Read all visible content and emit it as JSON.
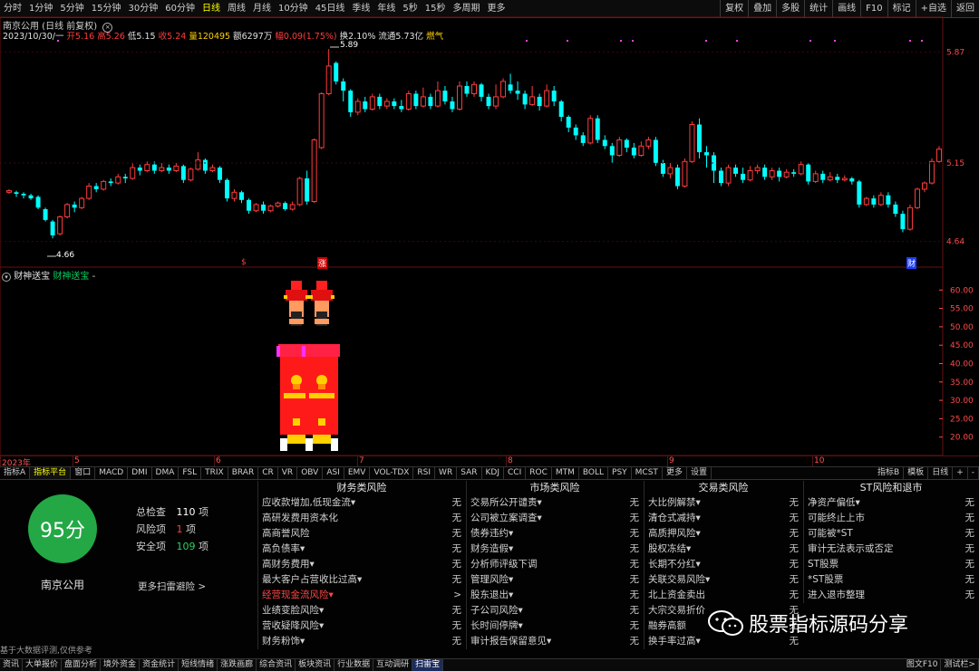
{
  "periods": [
    "分时",
    "1分钟",
    "5分钟",
    "15分钟",
    "30分钟",
    "60分钟",
    "日线",
    "周线",
    "月线",
    "10分钟",
    "45日线",
    "季线",
    "年线",
    "5秒",
    "15秒",
    "多周期",
    "更多"
  ],
  "active_period": "日线",
  "right_tools": [
    "复权",
    "叠加",
    "多股",
    "统计",
    "画线",
    "F10",
    "标记",
    "+自选",
    "返回"
  ],
  "stock": {
    "title": "南京公用 (日线 前复权)"
  },
  "quote": {
    "date": "2023/10/30/一",
    "open_label": "开",
    "open": "5.16",
    "high_label": "高",
    "high": "5.26",
    "low_label": "低",
    "low": "5.15",
    "close_label": "收",
    "close": "5.24",
    "vol_label": "量",
    "vol": "120495",
    "amt_label": "额",
    "amt": "6297万",
    "chg_label": "幅",
    "chg": "0.09(1.75%)",
    "turn_label": "换",
    "turn": "2.10%",
    "float_label": "流通",
    "float": "5.73亿",
    "tag": "燃气"
  },
  "price_labels": {
    "high_mark": "5.89",
    "low_mark": "4.66"
  },
  "markers": {
    "s": "$",
    "zhang": "涨",
    "cai": "财"
  },
  "sub_indicator": {
    "name": "财神送宝",
    "formula": "财神送宝",
    "suffix": "-"
  },
  "date_axis": [
    "2023年",
    "5",
    "6",
    "7",
    "8",
    "9",
    "10"
  ],
  "indicator_tabs": [
    "指标A",
    "指标平台",
    "窗口",
    "MACD",
    "DMI",
    "DMA",
    "FSL",
    "TRIX",
    "BRAR",
    "CR",
    "VR",
    "OBV",
    "ASI",
    "EMV",
    "VOL-TDX",
    "RSI",
    "WR",
    "SAR",
    "KDJ",
    "CCI",
    "ROC",
    "MTM",
    "BOLL",
    "PSY",
    "MCST",
    "更多",
    "设置"
  ],
  "indicator_right": [
    "指标B",
    "模板",
    "日线",
    "+",
    "-"
  ],
  "risk": {
    "score": "95分",
    "stock_name": "南京公用",
    "total_label": "总检查",
    "total": "110",
    "unit": "项",
    "risk_label": "风险项",
    "risk_count": "1",
    "safe_label": "安全项",
    "safe_count": "109",
    "more_link": "更多扫雷避险 >",
    "disclaimer": "基于大数据评测,仅供参考",
    "columns": [
      {
        "title": "财务类风险",
        "rows": [
          {
            "name": "应收款增加,低现金流▾",
            "value": "无"
          },
          {
            "name": "高研发费用资本化",
            "value": "无"
          },
          {
            "name": "高商誉风险",
            "value": "无"
          },
          {
            "name": "高负债率▾",
            "value": "无"
          },
          {
            "name": "高财务费用▾",
            "value": "无"
          },
          {
            "name": "最大客户占营收比过高▾",
            "value": "无"
          },
          {
            "name": "经营现金流风险▾",
            "value": ">",
            "hl": true
          },
          {
            "name": "业绩变脸风险▾",
            "value": "无"
          },
          {
            "name": "营收疑降风险▾",
            "value": "无"
          },
          {
            "name": "财务粉饰▾",
            "value": "无"
          }
        ]
      },
      {
        "title": "市场类风险",
        "rows": [
          {
            "name": "交易所公开谴责▾",
            "value": "无"
          },
          {
            "name": "公司被立案调查▾",
            "value": "无"
          },
          {
            "name": "债券违约▾",
            "value": "无"
          },
          {
            "name": "财务造假▾",
            "value": "无"
          },
          {
            "name": "分析师评级下调",
            "value": "无"
          },
          {
            "name": "管理风险▾",
            "value": "无"
          },
          {
            "name": "股东退出▾",
            "value": "无"
          },
          {
            "name": "子公司风险▾",
            "value": "无"
          },
          {
            "name": "长时间停牌▾",
            "value": "无"
          },
          {
            "name": "审计报告保留意见▾",
            "value": "无"
          }
        ]
      },
      {
        "title": "交易类风险",
        "rows": [
          {
            "name": "大比例解禁▾",
            "value": "无"
          },
          {
            "name": "清仓式减持▾",
            "value": "无"
          },
          {
            "name": "高质押风险▾",
            "value": "无"
          },
          {
            "name": "股权冻结▾",
            "value": "无"
          },
          {
            "name": "长期不分红▾",
            "value": "无"
          },
          {
            "name": "关联交易风险▾",
            "value": "无"
          },
          {
            "name": "北上资金卖出",
            "value": "无"
          },
          {
            "name": "大宗交易折价",
            "value": "无"
          },
          {
            "name": "融券高额",
            "value": "无"
          },
          {
            "name": "换手率过高▾",
            "value": "无"
          }
        ]
      },
      {
        "title": "ST风险和退市",
        "rows": [
          {
            "name": "净资产偏低▾",
            "value": "无"
          },
          {
            "name": "可能终止上市",
            "value": "无"
          },
          {
            "name": "可能被*ST",
            "value": "无"
          },
          {
            "name": "审计无法表示或否定",
            "value": "无"
          },
          {
            "name": "ST股票",
            "value": "无"
          },
          {
            "name": "*ST股票",
            "value": "无"
          },
          {
            "name": "进入退市整理",
            "value": "无"
          }
        ]
      }
    ]
  },
  "watermark": "股票指标源码分享",
  "bottom_tabs": [
    "资讯",
    "大单报价",
    "盘面分析",
    "境外资金",
    "资金统计",
    "短线情绪",
    "涨跌画廊",
    "综合资讯",
    "板块资讯",
    "行业数据",
    "互动调研",
    "扫雷宝"
  ],
  "bottom_active": "扫雷宝",
  "bottom_right": [
    "图文F10",
    "测试栏>"
  ],
  "colors": {
    "up": "#ff3c3c",
    "down": "#00ffff",
    "score_bg": "#23a845",
    "accent": "#ffff00"
  },
  "chart_data": {
    "type": "candlestick",
    "ylim": [
      4.55,
      5.95
    ],
    "y_ticks": [
      5.87,
      5.15,
      4.64
    ],
    "candles": [
      [
        4.96,
        4.97,
        4.95,
        4.98
      ],
      [
        4.96,
        4.95,
        4.93,
        4.97
      ],
      [
        4.95,
        4.94,
        4.92,
        4.96
      ],
      [
        4.94,
        4.92,
        4.91,
        4.95
      ],
      [
        4.93,
        4.86,
        4.85,
        4.94
      ],
      [
        4.85,
        4.78,
        4.77,
        4.86
      ],
      [
        4.77,
        4.68,
        4.66,
        4.78
      ],
      [
        4.69,
        4.8,
        4.68,
        4.81
      ],
      [
        4.8,
        4.88,
        4.79,
        4.89
      ],
      [
        4.88,
        4.86,
        4.83,
        4.9
      ],
      [
        4.86,
        4.92,
        4.85,
        4.93
      ],
      [
        4.92,
        5.0,
        4.91,
        5.02
      ],
      [
        5.0,
        4.98,
        4.96,
        5.02
      ],
      [
        4.98,
        5.03,
        4.97,
        5.04
      ],
      [
        5.03,
        5.02,
        5.0,
        5.05
      ],
      [
        5.02,
        5.06,
        5.01,
        5.08
      ],
      [
        5.06,
        5.05,
        5.02,
        5.08
      ],
      [
        5.05,
        5.12,
        5.04,
        5.15
      ],
      [
        5.12,
        5.1,
        5.07,
        5.14
      ],
      [
        5.1,
        5.14,
        5.09,
        5.16
      ],
      [
        5.14,
        5.1,
        5.08,
        5.16
      ],
      [
        5.1,
        5.12,
        5.09,
        5.15
      ],
      [
        5.12,
        5.1,
        5.08,
        5.14
      ],
      [
        5.1,
        5.13,
        5.09,
        5.15
      ],
      [
        5.13,
        5.04,
        5.02,
        5.14
      ],
      [
        5.04,
        5.11,
        5.03,
        5.12
      ],
      [
        5.11,
        5.17,
        5.1,
        5.22
      ],
      [
        5.17,
        5.1,
        5.08,
        5.18
      ],
      [
        5.1,
        5.12,
        5.09,
        5.14
      ],
      [
        5.12,
        5.04,
        5.02,
        5.13
      ],
      [
        5.04,
        4.92,
        4.9,
        5.05
      ],
      [
        4.92,
        4.96,
        4.9,
        4.98
      ],
      [
        4.96,
        4.91,
        4.89,
        4.97
      ],
      [
        4.91,
        4.84,
        4.82,
        4.92
      ],
      [
        4.84,
        4.88,
        4.83,
        4.89
      ],
      [
        4.88,
        4.84,
        4.82,
        4.9
      ],
      [
        4.84,
        4.87,
        4.83,
        4.88
      ],
      [
        4.87,
        4.89,
        4.86,
        4.9
      ],
      [
        4.89,
        4.85,
        4.84,
        4.9
      ],
      [
        4.85,
        4.88,
        4.84,
        4.9
      ],
      [
        4.88,
        5.05,
        4.87,
        5.06
      ],
      [
        5.05,
        4.9,
        4.88,
        5.1
      ],
      [
        4.9,
        5.3,
        4.89,
        5.31
      ],
      [
        5.25,
        5.6,
        5.24,
        5.61
      ],
      [
        5.6,
        5.78,
        5.59,
        5.89
      ],
      [
        5.8,
        5.68,
        5.66,
        5.81
      ],
      [
        5.68,
        5.62,
        5.55,
        5.7
      ],
      [
        5.62,
        5.48,
        5.45,
        5.63
      ],
      [
        5.48,
        5.55,
        5.46,
        5.57
      ],
      [
        5.55,
        5.5,
        5.48,
        5.58
      ],
      [
        5.5,
        5.58,
        5.49,
        5.6
      ],
      [
        5.58,
        5.52,
        5.5,
        5.6
      ],
      [
        5.52,
        5.55,
        5.5,
        5.57
      ],
      [
        5.55,
        5.52,
        5.5,
        5.57
      ],
      [
        5.52,
        5.5,
        5.48,
        5.56
      ],
      [
        5.5,
        5.6,
        5.49,
        5.62
      ],
      [
        5.6,
        5.52,
        5.5,
        5.62
      ],
      [
        5.52,
        5.58,
        5.51,
        5.64
      ],
      [
        5.58,
        5.52,
        5.5,
        5.6
      ],
      [
        5.52,
        5.62,
        5.51,
        5.68
      ],
      [
        5.62,
        5.55,
        5.53,
        5.65
      ],
      [
        5.55,
        5.5,
        5.48,
        5.58
      ],
      [
        5.5,
        5.65,
        5.49,
        5.68
      ],
      [
        5.65,
        5.6,
        5.58,
        5.68
      ],
      [
        5.6,
        5.66,
        5.58,
        5.68
      ],
      [
        5.66,
        5.58,
        5.55,
        5.67
      ],
      [
        5.58,
        5.52,
        5.5,
        5.6
      ],
      [
        5.52,
        5.58,
        5.5,
        5.66
      ],
      [
        5.58,
        5.68,
        5.57,
        5.7
      ],
      [
        5.66,
        5.62,
        5.6,
        5.73
      ],
      [
        5.62,
        5.6,
        5.56,
        5.68
      ],
      [
        5.6,
        5.53,
        5.5,
        5.62
      ],
      [
        5.53,
        5.58,
        5.52,
        5.65
      ],
      [
        5.58,
        5.52,
        5.49,
        5.6
      ],
      [
        5.52,
        5.62,
        5.51,
        5.66
      ],
      [
        5.62,
        5.55,
        5.52,
        5.65
      ],
      [
        5.55,
        5.45,
        5.42,
        5.56
      ],
      [
        5.45,
        5.38,
        5.35,
        5.46
      ],
      [
        5.38,
        5.33,
        5.3,
        5.4
      ],
      [
        5.33,
        5.28,
        5.26,
        5.35
      ],
      [
        5.28,
        5.44,
        5.27,
        5.46
      ],
      [
        5.44,
        5.3,
        5.28,
        5.46
      ],
      [
        5.3,
        5.26,
        5.24,
        5.33
      ],
      [
        5.26,
        5.2,
        5.15,
        5.28
      ],
      [
        5.2,
        5.3,
        5.19,
        5.32
      ],
      [
        5.3,
        5.25,
        5.22,
        5.31
      ],
      [
        5.25,
        5.2,
        5.18,
        5.28
      ],
      [
        5.2,
        5.26,
        5.19,
        5.29
      ],
      [
        5.26,
        5.3,
        5.24,
        5.32
      ],
      [
        5.3,
        5.15,
        5.13,
        5.32
      ],
      [
        5.15,
        5.08,
        5.06,
        5.17
      ],
      [
        5.08,
        5.12,
        5.05,
        5.15
      ],
      [
        5.12,
        5.0,
        4.98,
        5.14
      ],
      [
        5.0,
        5.16,
        4.99,
        5.18
      ],
      [
        5.16,
        5.4,
        5.15,
        5.42
      ],
      [
        5.4,
        5.22,
        5.18,
        5.44
      ],
      [
        5.22,
        5.2,
        5.12,
        5.26
      ],
      [
        5.2,
        5.1,
        5.02,
        5.22
      ],
      [
        5.1,
        5.02,
        5.0,
        5.12
      ],
      [
        5.02,
        5.12,
        5.0,
        5.14
      ],
      [
        5.12,
        5.08,
        5.06,
        5.14
      ],
      [
        5.08,
        5.04,
        5.02,
        5.12
      ],
      [
        5.04,
        5.1,
        5.03,
        5.13
      ],
      [
        5.1,
        5.12,
        5.08,
        5.14
      ],
      [
        5.12,
        5.06,
        5.04,
        5.14
      ],
      [
        5.06,
        5.1,
        5.04,
        5.12
      ],
      [
        5.1,
        5.06,
        5.03,
        5.12
      ],
      [
        5.06,
        5.09,
        5.05,
        5.11
      ],
      [
        5.09,
        5.08,
        5.06,
        5.11
      ],
      [
        5.08,
        5.14,
        5.07,
        5.16
      ],
      [
        5.14,
        5.03,
        5.01,
        5.15
      ],
      [
        5.03,
        5.08,
        5.02,
        5.1
      ],
      [
        5.08,
        5.04,
        5.02,
        5.1
      ],
      [
        5.04,
        5.06,
        5.03,
        5.09
      ],
      [
        5.06,
        5.04,
        5.02,
        5.08
      ],
      [
        5.04,
        5.05,
        5.03,
        5.07
      ],
      [
        5.05,
        5.03,
        5.01,
        5.06
      ],
      [
        5.03,
        4.88,
        4.86,
        5.04
      ],
      [
        4.88,
        4.92,
        4.87,
        4.93
      ],
      [
        4.92,
        4.88,
        4.86,
        4.94
      ],
      [
        4.88,
        4.94,
        4.87,
        4.96
      ],
      [
        4.94,
        4.88,
        4.86,
        4.96
      ],
      [
        4.88,
        4.82,
        4.8,
        4.9
      ],
      [
        4.82,
        4.72,
        4.7,
        4.84
      ],
      [
        4.72,
        4.86,
        4.71,
        4.88
      ],
      [
        4.86,
        4.98,
        4.85,
        4.99
      ],
      [
        4.98,
        5.02,
        4.96,
        5.03
      ],
      [
        5.02,
        5.16,
        5.01,
        5.18
      ],
      [
        5.16,
        5.24,
        5.15,
        5.26
      ]
    ],
    "sub_ylim": [
      15,
      65
    ],
    "sub_ticks": [
      60,
      55,
      50,
      45,
      40,
      35,
      30,
      25,
      20
    ]
  }
}
